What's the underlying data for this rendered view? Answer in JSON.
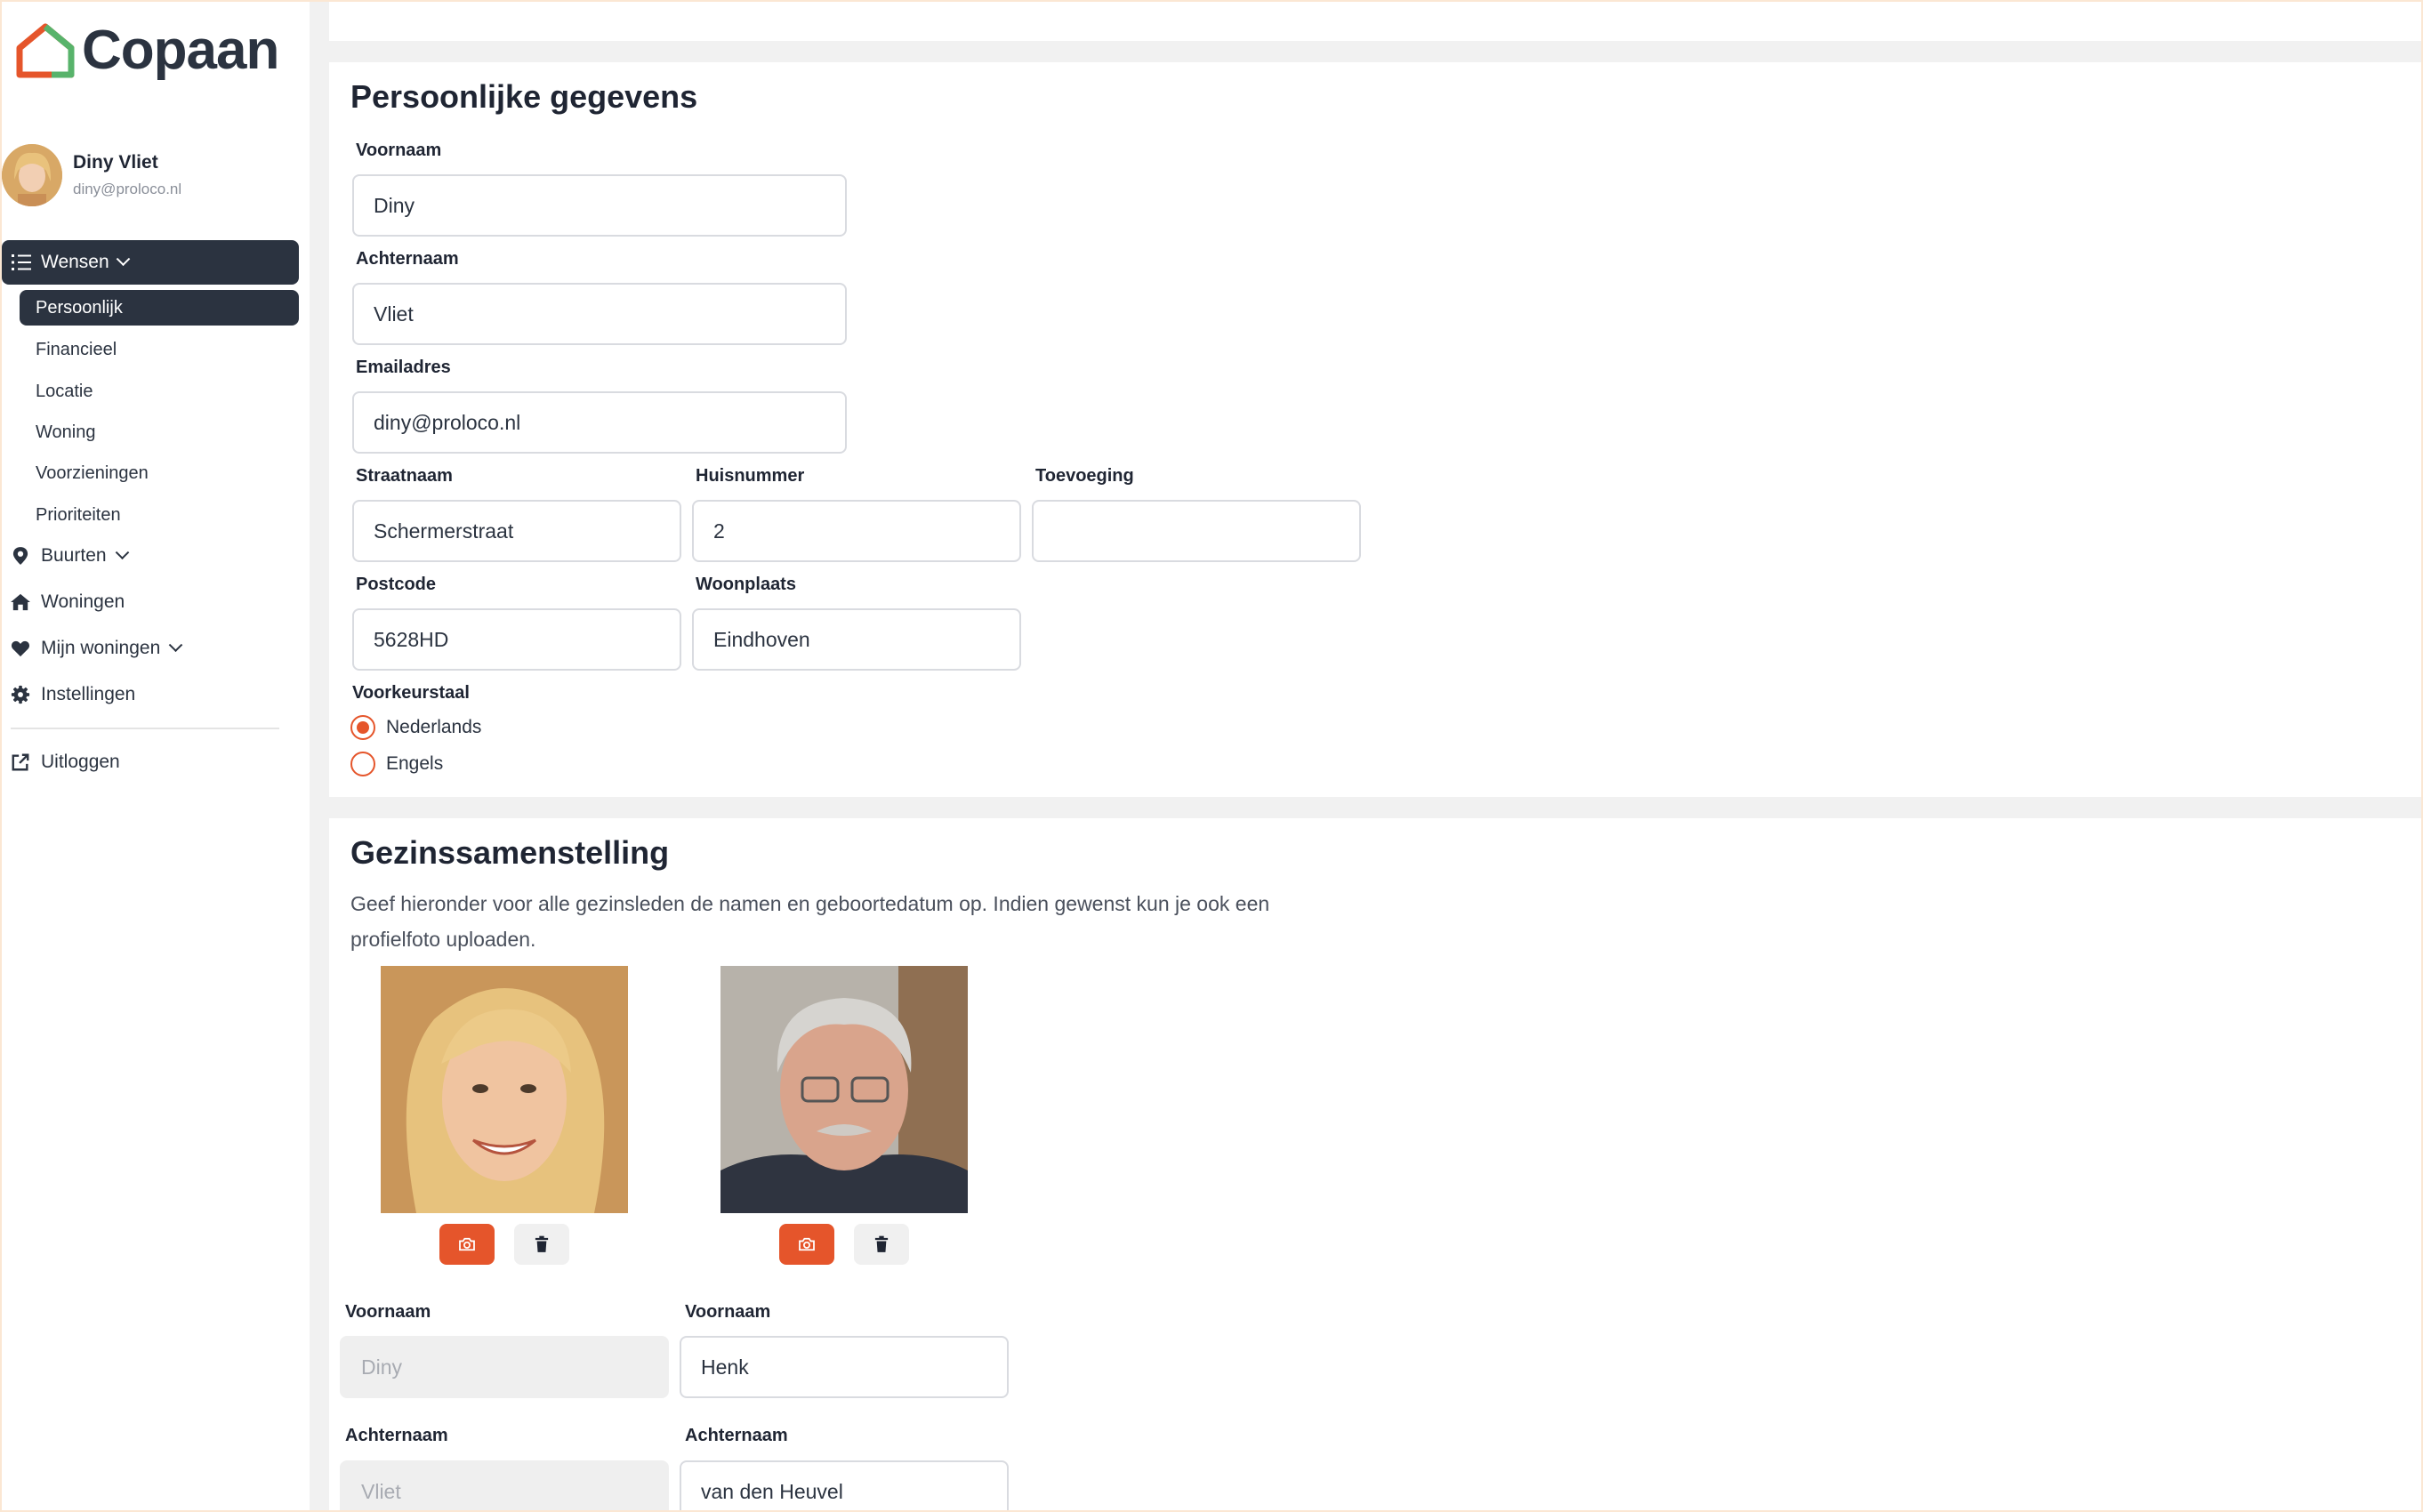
{
  "app": {
    "logo_text": "Copaan",
    "brand_color": "#e5552b",
    "dark_color": "#2b3340"
  },
  "user": {
    "name": "Diny Vliet",
    "email": "diny@proloco.nl"
  },
  "sidebar": {
    "main_item": {
      "label": "Wensen",
      "icon": "list-icon"
    },
    "sub_items": [
      {
        "label": "Persoonlijk",
        "active": true
      },
      {
        "label": "Financieel"
      },
      {
        "label": "Locatie"
      },
      {
        "label": "Woning"
      },
      {
        "label": "Voorzieningen"
      },
      {
        "label": "Prioriteiten"
      }
    ],
    "items": [
      {
        "label": "Buurten",
        "icon": "map-pin-icon",
        "has_dropdown": true
      },
      {
        "label": "Woningen",
        "icon": "home-icon"
      },
      {
        "label": "Mijn woningen",
        "icon": "heart-icon",
        "has_dropdown": true
      },
      {
        "label": "Instellingen",
        "icon": "gear-icon"
      }
    ],
    "logout": {
      "label": "Uitloggen",
      "icon": "external-link-icon"
    }
  },
  "personal": {
    "title": "Persoonlijke gegevens",
    "voornaam": {
      "label": "Voornaam",
      "value": "Diny"
    },
    "achternaam": {
      "label": "Achternaam",
      "value": "Vliet"
    },
    "email": {
      "label": "Emailadres",
      "value": "diny@proloco.nl"
    },
    "straatnaam": {
      "label": "Straatnaam",
      "value": "Schermerstraat"
    },
    "huisnummer": {
      "label": "Huisnummer",
      "value": "2"
    },
    "toevoeging": {
      "label": "Toevoeging",
      "value": ""
    },
    "postcode": {
      "label": "Postcode",
      "value": "5628HD"
    },
    "woonplaats": {
      "label": "Woonplaats",
      "value": "Eindhoven"
    },
    "language": {
      "label": "Voorkeurstaal",
      "options": [
        {
          "label": "Nederlands",
          "selected": true
        },
        {
          "label": "Engels",
          "selected": false
        }
      ]
    }
  },
  "family": {
    "title": "Gezinssamenstelling",
    "intro": "Geef hieronder voor alle gezinsleden de namen en geboortedatum op. Indien gewenst kun je ook een profielfoto uploaden.",
    "members": [
      {
        "voornaam_label": "Voornaam",
        "voornaam": "Diny",
        "achternaam_label": "Achternaam",
        "achternaam": "Vliet",
        "disabled": true
      },
      {
        "voornaam_label": "Voornaam",
        "voornaam": "Henk",
        "achternaam_label": "Achternaam",
        "achternaam": "van den Heuvel",
        "disabled": false
      }
    ]
  }
}
